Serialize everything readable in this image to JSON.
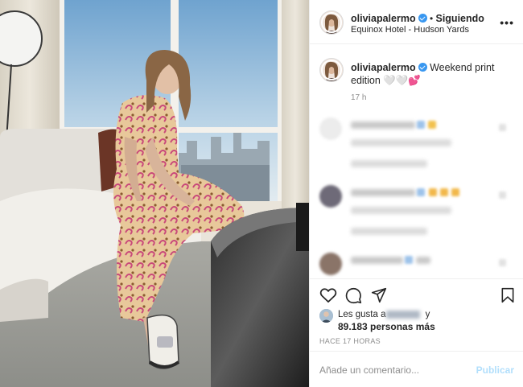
{
  "post": {
    "username": "oliviapalermo",
    "follow_state": "Siguiendo",
    "location": "Equinox Hotel - Hudson Yards",
    "more_icon": "more-horizontal-icon"
  },
  "caption": {
    "username": "oliviapalermo",
    "text": " Weekend print edition 🤍🤍💕",
    "time": "17 h"
  },
  "actions": {
    "icons": [
      "heart-icon",
      "comment-icon",
      "share-icon",
      "bookmark-icon"
    ]
  },
  "likes": {
    "prefix": "Les gusta a",
    "suffix": " y",
    "others": "89.183 personas más"
  },
  "timestamp": "HACE 17 HORAS",
  "add_comment": {
    "placeholder": "Añade un comentario...",
    "post_label": "Publicar"
  },
  "colors": {
    "verified": "#3897f0",
    "publish_disabled": "#b2dffc",
    "muted": "#8e8e8e"
  }
}
